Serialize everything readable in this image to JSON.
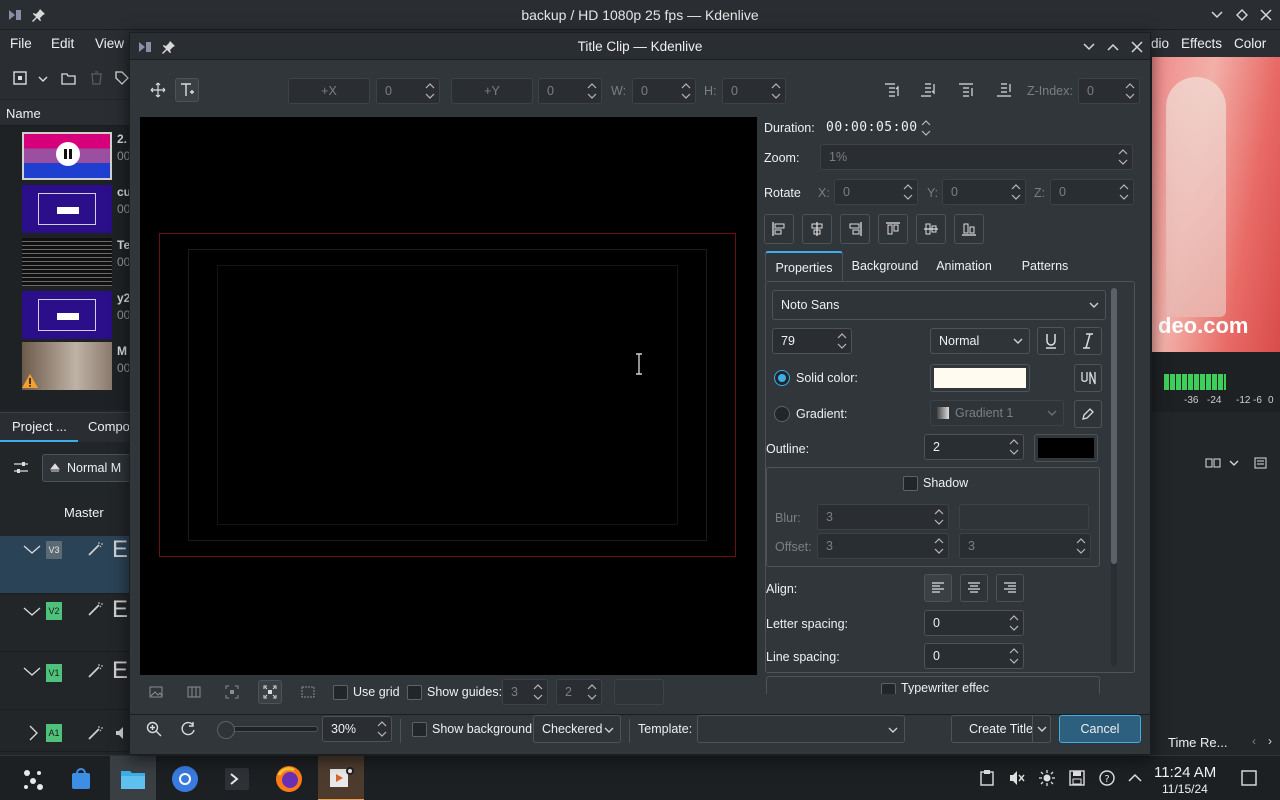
{
  "main": {
    "title": "backup / HD 1080p 25 fps — Kdenlive",
    "menus": [
      "File",
      "Edit",
      "View"
    ],
    "right_menus": [
      "dio",
      "Effects",
      "Color"
    ],
    "bin": {
      "name_header": "Name",
      "clips": [
        {
          "title": "2.",
          "sub": "00"
        },
        {
          "title": "cu",
          "sub": "00"
        },
        {
          "title": "Te",
          "sub": "00"
        },
        {
          "title": "y2",
          "sub": "00"
        },
        {
          "title": "M",
          "sub": "00"
        }
      ],
      "tabs": [
        "Project ...",
        "Compo"
      ],
      "mix_label": "Normal M",
      "master_label": "Master",
      "tracks": [
        {
          "tag": "V3",
          "color": "#5c6b73"
        },
        {
          "tag": "V2",
          "color": "#4ec27a"
        },
        {
          "tag": "V1",
          "color": "#4ec27a"
        },
        {
          "tag": "A1",
          "color": "#4ec27a"
        }
      ]
    },
    "monitor_overlay": "deo.com",
    "vu_scale": [
      "-36",
      "-24",
      "-12",
      "-6",
      "0"
    ],
    "time_remap": "Time Re..."
  },
  "dialog": {
    "title": "Title Clip — Kdenlive",
    "toolbar": {
      "x_button": "+X",
      "x_value": "0",
      "y_button": "+Y",
      "y_value": "0",
      "w_label": "W:",
      "w_value": "0",
      "h_label": "H:",
      "h_value": "0",
      "zindex_label": "Z-Index:",
      "zindex_value": "0"
    },
    "duration_label": "Duration:",
    "duration_value": "00:00:05:00",
    "zoom_label": "Zoom:",
    "zoom_value": "1%",
    "rotate_label": "Rotate",
    "rotate_x_label": "X:",
    "rotate_x_value": "0",
    "rotate_y_label": "Y:",
    "rotate_y_value": "0",
    "rotate_z_label": "Z:",
    "rotate_z_value": "0",
    "tabs": [
      "Properties",
      "Background",
      "Animation",
      "Patterns"
    ],
    "active_tab": "Properties",
    "properties": {
      "font": "Noto Sans",
      "size": "79",
      "weight": "Normal",
      "solid_color_label": "Solid color:",
      "solid_color_value": "#fffbf0",
      "gradient_label": "Gradient:",
      "gradient_value": "Gradient 1",
      "outline_label": "Outline:",
      "outline_value": "2",
      "outline_color": "#000000",
      "shadow_label": "Shadow",
      "blur_label": "Blur:",
      "blur_value": "3",
      "offset_label": "Offset:",
      "offset_x": "3",
      "offset_y": "3",
      "align_label": "Align:",
      "letter_spacing_label": "Letter spacing:",
      "letter_spacing_value": "0",
      "line_spacing_label": "Line spacing:",
      "line_spacing_value": "0",
      "typewriter_label": "Typewriter effect"
    },
    "bottom": {
      "use_grid": "Use grid",
      "show_guides": "Show guides:",
      "guides_a": "3",
      "guides_b": "2",
      "zoom_value": "30%",
      "show_background": "Show background",
      "background_mode": "Checkered",
      "template_label": "Template:",
      "create_button": "Create Title",
      "cancel_button": "Cancel"
    }
  },
  "taskbar": {
    "time": "11:24 AM",
    "date": "11/15/24"
  }
}
